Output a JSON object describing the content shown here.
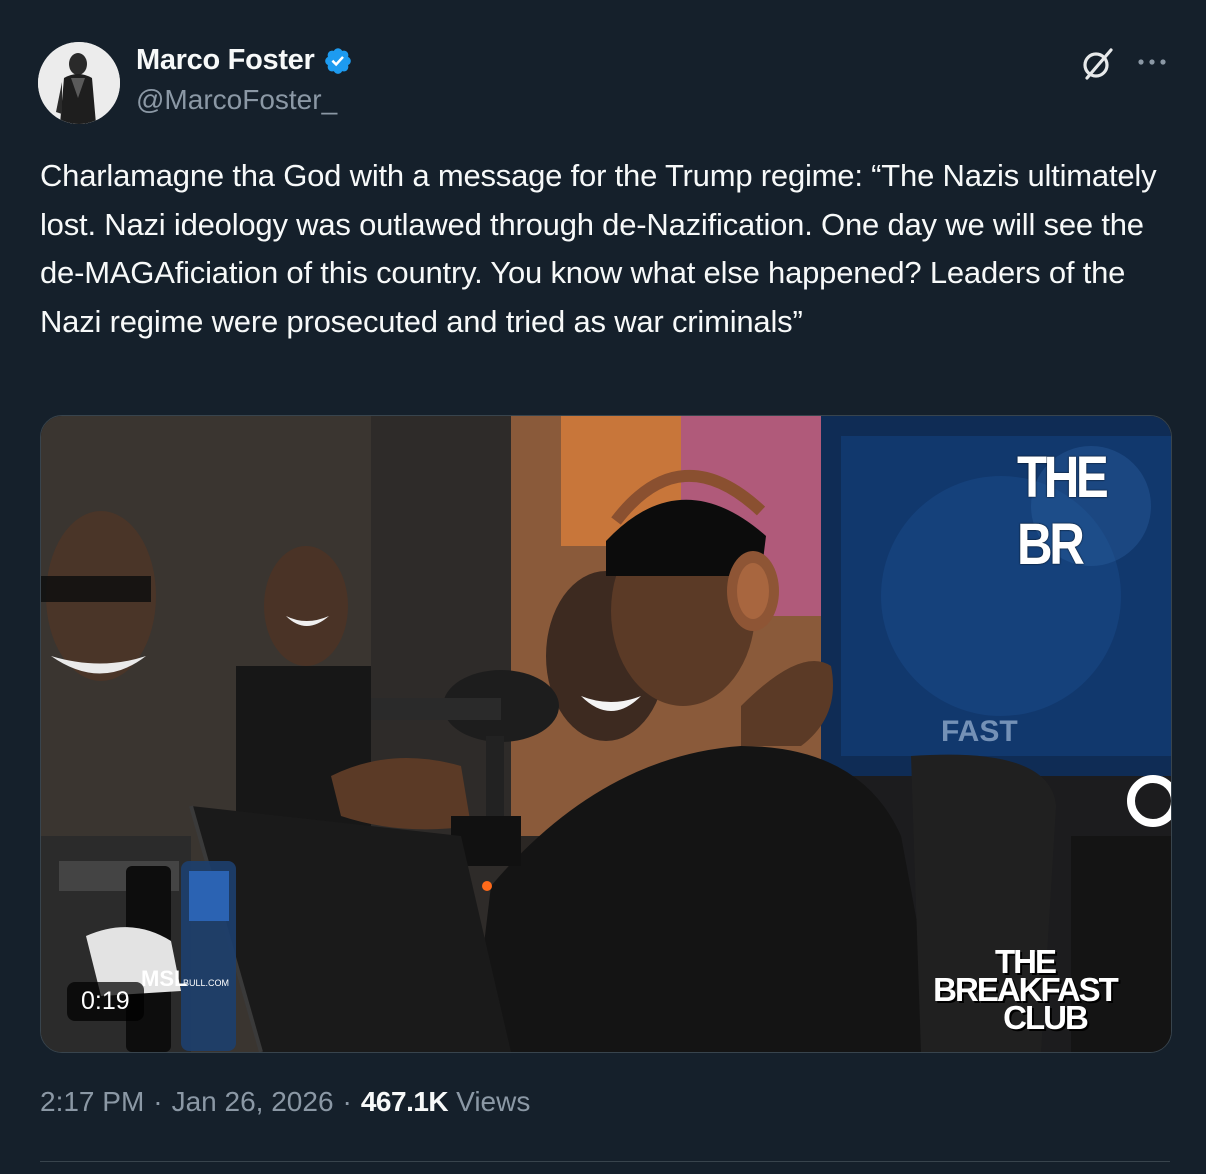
{
  "author": {
    "display_name": "Marco Foster",
    "handle": "@MarcoFoster_",
    "verified": true
  },
  "header": {
    "grok_icon": "grok-icon",
    "more_icon": "more-icon",
    "more_label": "···"
  },
  "tweet": {
    "text": "Charlamagne tha God with a message for the Trump regime: “The Nazis ultimately lost. Nazi ideology was outlawed through de-Nazification. One day we will see the de-MAGAficiation of this country. You know what else happened? Leaders of the Nazi regime were prosecuted and tried as war criminals”"
  },
  "media": {
    "type": "video",
    "duration": "0:19",
    "watermark_top": "THE BR",
    "watermark_bottom_line1": "THE BREAKFAST",
    "watermark_bottom_line2": "CLUB",
    "bottle_text": "MSL",
    "bottle_url": "BULL.COM"
  },
  "footer": {
    "time": "2:17 PM",
    "separator": "·",
    "date": "Jan 26, 2026",
    "views_count": "467.1K",
    "views_label": "Views"
  },
  "colors": {
    "background": "#15202b",
    "text_primary": "#f7f9f9",
    "text_secondary": "#8b98a5",
    "verified_blue": "#1d9bf0",
    "border": "#38444d"
  }
}
